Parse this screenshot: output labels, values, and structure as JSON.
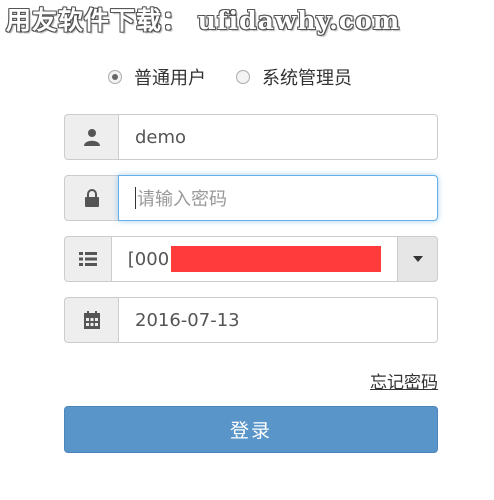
{
  "watermark": {
    "text": "用友软件下载： ufidawhy.com"
  },
  "role": {
    "options": [
      {
        "label": "普通用户",
        "selected": true
      },
      {
        "label": "系统管理员",
        "selected": false
      }
    ]
  },
  "username": {
    "value": "demo"
  },
  "password": {
    "placeholder": "请输入密码",
    "value": ""
  },
  "account": {
    "value": "[000"
  },
  "date": {
    "value": "2016-07-13"
  },
  "forgot_label": "忘记密码",
  "login_label": "登录",
  "icons": {
    "username": "user-icon",
    "password": "lock-icon",
    "account": "list-icon",
    "date": "calendar-icon",
    "dropdown": "caret-down-icon"
  },
  "colors": {
    "primary_button": "#5a95c9",
    "focus_border": "#66afe9",
    "redaction": "#ff3b3b"
  }
}
